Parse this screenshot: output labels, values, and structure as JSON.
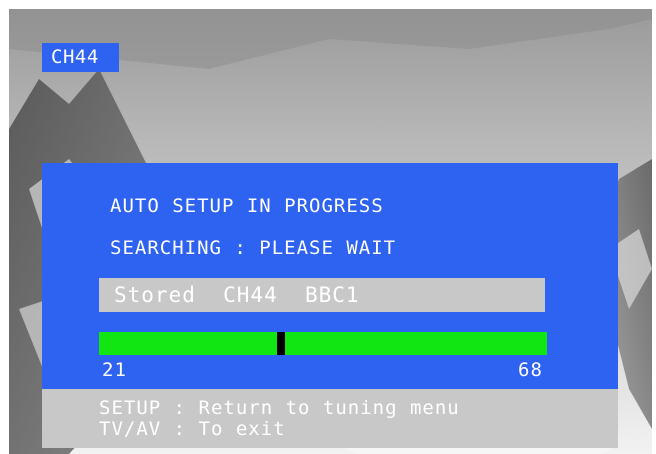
{
  "channel_badge": "CH44",
  "panel": {
    "title": "AUTO SETUP IN PROGRESS",
    "status": "SEARCHING : PLEASE WAIT",
    "stored_text": "Stored  CH44  BBC1",
    "progress": {
      "min_label": "21",
      "max_label": "68",
      "min": 21,
      "max": 68,
      "current": 40
    }
  },
  "help": {
    "line1": "SETUP : Return to tuning menu",
    "line2": "TV/AV : To exit"
  },
  "colors": {
    "panel_blue": "#2e62f0",
    "progress_green": "#12e612",
    "gray_bar": "#c8c8c8"
  }
}
